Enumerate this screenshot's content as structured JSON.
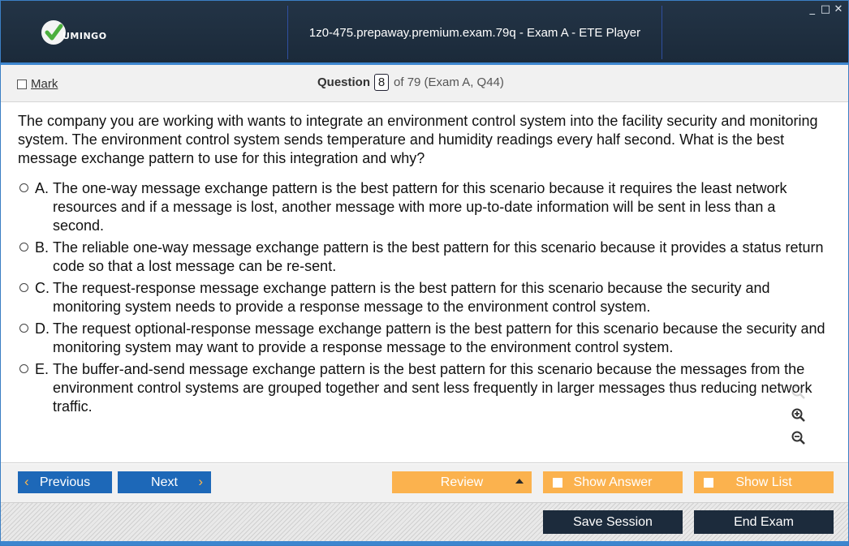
{
  "window": {
    "title": "1z0-475.prepaway.premium.exam.79q - Exam A - ETE Player",
    "controls": {
      "minimize": "_",
      "maximize": "□",
      "close": "✕"
    },
    "logo": {
      "icon": "vumingo-check-logo",
      "text": "UMINGO"
    }
  },
  "header": {
    "mark_label": "Mark",
    "question_word": "Question",
    "question_number": "8",
    "question_of": "of 79 (Exam A, Q44)"
  },
  "question": {
    "text": "The company you are working with wants to integrate an environment control system into the facility security and monitoring system. The environment control system sends temperature and humidity readings every half second. What is the best message exchange pattern to use for this integration and why?",
    "options": [
      {
        "letter": "A.",
        "text": "The one-way message exchange pattern is the best pattern for this scenario because it requires the least network resources and if a message is lost, another message with more up-to-date information will be sent in less than a second."
      },
      {
        "letter": "B.",
        "text": "The reliable one-way message exchange pattern is the best pattern for this scenario because it provides a status return code so that a lost message can be re-sent."
      },
      {
        "letter": "C.",
        "text": "The request-response message exchange pattern is the best pattern for this scenario because the security and monitoring system needs to provide a response message to the environment control system."
      },
      {
        "letter": "D.",
        "text": "The request optional-response message exchange pattern is the best pattern for this scenario because the security and monitoring system may want to provide a response message to the environment control system."
      },
      {
        "letter": "E.",
        "text": "The buffer-and-send message exchange pattern is the best pattern for this scenario because the messages from the environment control systems are grouped together and sent less frequently in larger messages thus reducing network traffic."
      }
    ]
  },
  "zoom": {
    "icons": [
      "zoom-reset-icon",
      "zoom-in-icon",
      "zoom-out-icon"
    ]
  },
  "nav": {
    "previous_label": "Previous",
    "next_label": "Next",
    "review_label": "Review",
    "show_answer_label": "Show Answer",
    "show_list_label": "Show List"
  },
  "footer": {
    "save_session_label": "Save Session",
    "end_exam_label": "End Exam"
  },
  "colors": {
    "titlebar": "#1b2a3a",
    "accent_blue": "#1d68b8",
    "accent_orange": "#fbb24e",
    "navy_button": "#1c2b3c",
    "logo_green": "#4caf3e"
  }
}
